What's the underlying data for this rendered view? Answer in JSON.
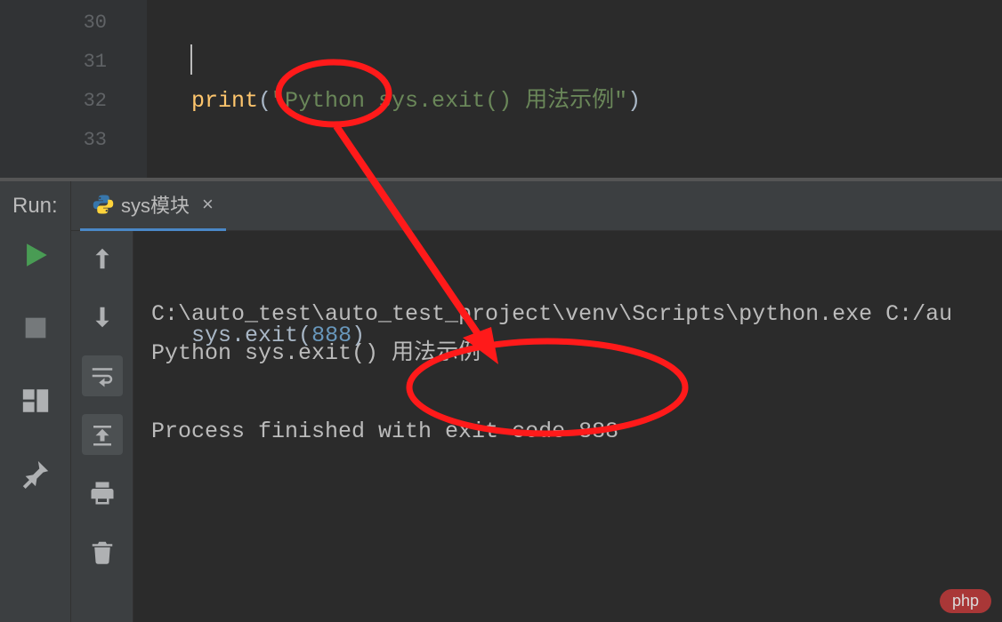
{
  "editor": {
    "lines": {
      "l30_num": "30",
      "l31_num": "31",
      "l32_num": "32",
      "l33_num": "33"
    },
    "code": {
      "l30_print": "print",
      "l30_lp": "(",
      "l30_str": "\"Python sys.exit() 用法示例\"",
      "l30_rp": ")",
      "l32_sys": "sys",
      "l32_dot": ".",
      "l32_exit": "exit",
      "l32_lp": "(",
      "l32_num": "888",
      "l32_rp": ")"
    }
  },
  "run": {
    "title": "Run:",
    "tab_label": "sys模块",
    "tab_close": "×",
    "output": {
      "line1": "C:\\auto_test\\auto_test_project\\venv\\Scripts\\python.exe C:/au",
      "line2": "Python sys.exit() 用法示例",
      "line3": "",
      "line4": "Process finished with exit code 888"
    }
  },
  "watermark": "php"
}
